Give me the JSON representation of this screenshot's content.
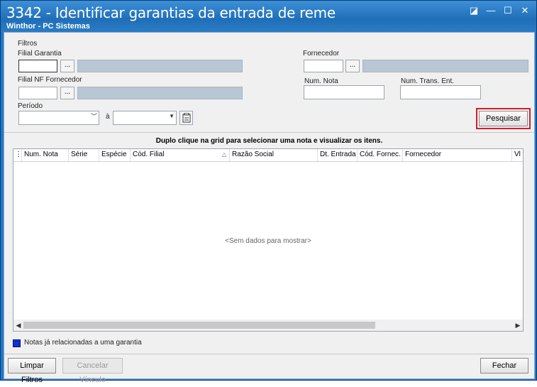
{
  "window": {
    "title": "3342 - Identificar garantias da entrada de reme",
    "subtitle": "Winthor - PC Sistemas",
    "controls": {
      "restore": "◪",
      "minimize": "—",
      "maximize": "☐",
      "close": "✕"
    }
  },
  "filters": {
    "group_label": "Filtros",
    "filial_garantia_label": "Filial Garantia",
    "filial_nf_label": "Filial NF Fornecedor",
    "periodo_label": "Período",
    "periodo_sep": "à",
    "fornecedor_label": "Fornecedor",
    "num_nota_label": "Num. Nota",
    "num_trans_label": "Num. Trans. Ent.",
    "ellipsis": "...",
    "search_button": "Pesquisar"
  },
  "grid": {
    "hint": "Duplo clique na grid para selecionar uma nota e visualizar os itens.",
    "columns": [
      "Num. Nota",
      "Série",
      "Espécie",
      "Cód. Filial",
      "Razão Social",
      "Dt. Entrada",
      "Cód. Fornec.",
      "Fornecedor",
      "Vl"
    ],
    "empty_text": "<Sem dados para mostrar>"
  },
  "legend": {
    "text": "Notas já relacionadas a uma garantia",
    "color": "#1030d0"
  },
  "footer": {
    "clear_button": "Limpar Filtros",
    "cancel_link_button": "Cancelar Vínculo",
    "close_button": "Fechar"
  }
}
